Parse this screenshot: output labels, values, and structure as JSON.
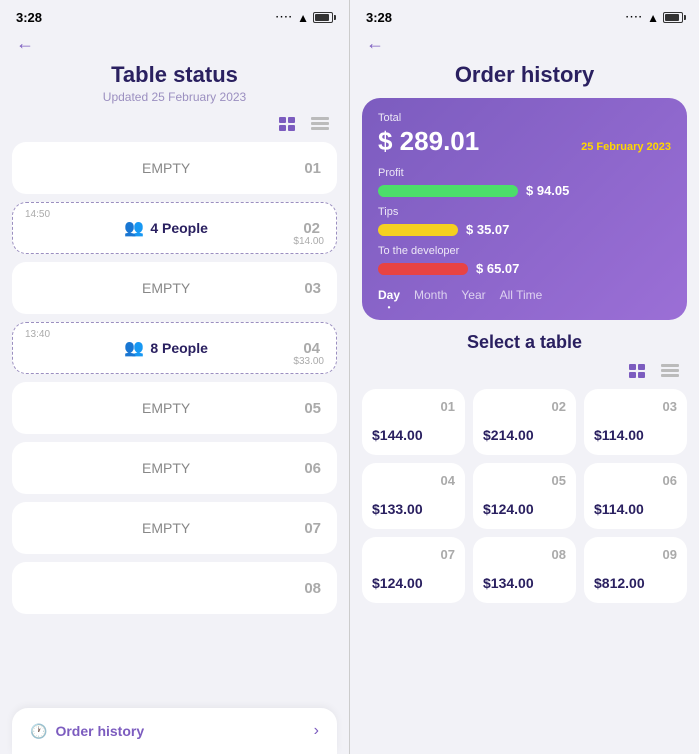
{
  "left": {
    "statusBar": {
      "time": "3:28"
    },
    "title": "Table status",
    "subtitle": "Updated 25 February 2023",
    "tables": [
      {
        "number": "01",
        "type": "empty",
        "label": "EMPTY"
      },
      {
        "number": "02",
        "type": "occupied",
        "people": "4 People",
        "time": "14:50",
        "amount": "$14.00"
      },
      {
        "number": "03",
        "type": "empty",
        "label": "EMPTY"
      },
      {
        "number": "04",
        "type": "occupied",
        "people": "8 People",
        "time": "13:40",
        "amount": "$33.00"
      },
      {
        "number": "05",
        "type": "empty",
        "label": "EMPTY"
      },
      {
        "number": "06",
        "type": "empty",
        "label": "EMPTY"
      },
      {
        "number": "07",
        "type": "empty",
        "label": "EMPTY"
      },
      {
        "number": "08",
        "type": "empty",
        "label": ""
      }
    ],
    "orderHistoryBar": {
      "label": "Order history",
      "icon": "🕐"
    }
  },
  "right": {
    "statusBar": {
      "time": "3:28"
    },
    "title": "Order history",
    "card": {
      "totalLabel": "Total",
      "totalAmount": "$ 289.01",
      "date": "25 February 2023",
      "profit": {
        "label": "Profit",
        "amount": "$ 94.05"
      },
      "tips": {
        "label": "Tips",
        "amount": "$ 35.07"
      },
      "developer": {
        "label": "To the developer",
        "amount": "$ 65.07"
      },
      "tabs": [
        "Day",
        "Month",
        "Year",
        "All Time"
      ],
      "activeTab": "Day"
    },
    "selectTable": {
      "title": "Select a table",
      "tables": [
        {
          "number": "01",
          "amount": "$144.00"
        },
        {
          "number": "02",
          "amount": "$214.00"
        },
        {
          "number": "03",
          "amount": "$114.00"
        },
        {
          "number": "04",
          "amount": "$133.00"
        },
        {
          "number": "05",
          "amount": "$124.00"
        },
        {
          "number": "06",
          "amount": "$114.00"
        },
        {
          "number": "07",
          "amount": "$124.00"
        },
        {
          "number": "08",
          "amount": "$134.00"
        },
        {
          "number": "09",
          "amount": "$812.00"
        }
      ]
    }
  }
}
